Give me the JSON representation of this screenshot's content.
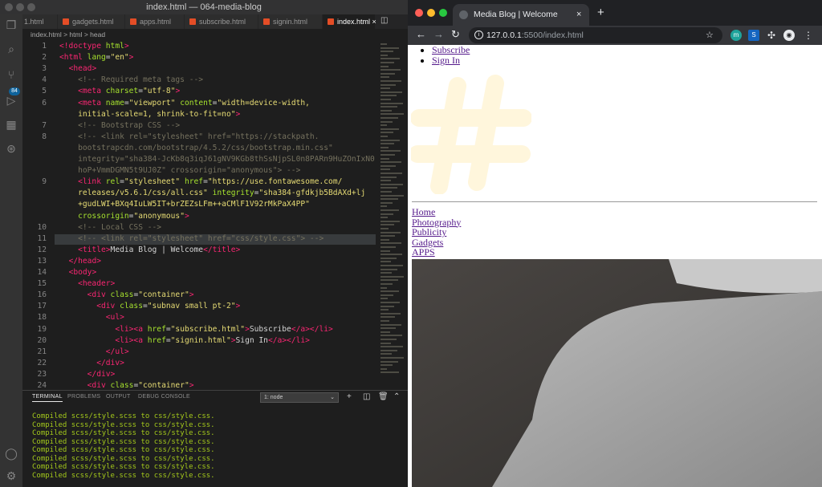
{
  "vscode": {
    "window_title": "index.html — 064-media-blog",
    "tabs": [
      "1.html",
      "gadgets.html",
      "apps.html",
      "subscribe.html",
      "signin.html",
      "index.html"
    ],
    "active_tab_close": "×",
    "breadcrumb": "index.html > html > head",
    "activity_badge": "84",
    "lines": [
      {
        "n": "1",
        "h": "<span class='t'>&lt;!doctype</span> <span class='a'>html</span><span class='t'>&gt;</span>"
      },
      {
        "n": "2",
        "h": "<span class='t'>&lt;html</span> <span class='a'>lang</span>=<span class='s'>\"en\"</span><span class='t'>&gt;</span>"
      },
      {
        "n": "3",
        "h": "  <span class='t'>&lt;head&gt;</span>"
      },
      {
        "n": "4",
        "h": "    <span class='c'>&lt;!-- Required meta tags --&gt;</span>"
      },
      {
        "n": "5",
        "h": "    <span class='t'>&lt;meta</span> <span class='a'>charset</span>=<span class='s'>\"utf-8\"</span><span class='t'>&gt;</span>"
      },
      {
        "n": "6",
        "h": "    <span class='t'>&lt;meta</span> <span class='a'>name</span>=<span class='s'>\"viewport\"</span> <span class='a'>content</span>=<span class='s'>\"width=device-width,</span>"
      },
      {
        "n": "",
        "h": "    <span class='s'>initial-scale=1, shrink-to-fit=no\"</span><span class='t'>&gt;</span>"
      },
      {
        "n": "7",
        "h": "    <span class='c'>&lt;!-- Bootstrap CSS --&gt;</span>"
      },
      {
        "n": "8",
        "h": "    <span class='c'>&lt;!-- &lt;link rel=\"stylesheet\" href=\"https://stackpath.</span>"
      },
      {
        "n": "",
        "h": "    <span class='c'>bootstrapcdn.com/bootstrap/4.5.2/css/bootstrap.min.css\"</span>"
      },
      {
        "n": "",
        "h": "    <span class='c'>integrity=\"sha384-JcKb8q3iqJ61gNV9KGb8thSsNjpSL0n8PARn9HuZOnIxN0</span>"
      },
      {
        "n": "",
        "h": "    <span class='c'>hoP+VmmDGMN5t9UJ0Z\" crossorigin=\"anonymous\"&gt; --&gt;</span>"
      },
      {
        "n": "9",
        "h": "    <span class='t'>&lt;link</span> <span class='a'>rel</span>=<span class='s'>\"stylesheet\"</span> <span class='a'>href</span>=<span class='s'>\"https://use.fontawesome.com/</span>"
      },
      {
        "n": "",
        "h": "    <span class='s'>releases/v5.6.1/css/all.css\"</span> <span class='a'>integrity</span>=<span class='s'>\"sha384-gfdkjb5BdAXd+lj</span>"
      },
      {
        "n": "",
        "h": "    <span class='s'>+gudLWI+BXq4IuLW5IT+brZEZsLFm++aCMlF1V92rMkPaX4PP\"</span>"
      },
      {
        "n": "",
        "h": "    <span class='a'>crossorigin</span>=<span class='s'>\"anonymous\"</span><span class='t'>&gt;</span>"
      },
      {
        "n": "10",
        "h": "    <span class='c'>&lt;!-- Local CSS --&gt;</span>"
      },
      {
        "n": "11",
        "h": "    <span class='c'>&lt;!-- &lt;link rel=\"stylesheet\" href=\"css/style.css\"&gt; --&gt;</span>"
      },
      {
        "n": "12",
        "h": "    <span class='t'>&lt;title&gt;</span>Media Blog | Welcome<span class='t'>&lt;/title&gt;</span>"
      },
      {
        "n": "13",
        "h": "  <span class='t'>&lt;/head&gt;</span>"
      },
      {
        "n": "14",
        "h": "  <span class='t'>&lt;body&gt;</span>"
      },
      {
        "n": "15",
        "h": "    <span class='t'>&lt;header&gt;</span>"
      },
      {
        "n": "16",
        "h": "      <span class='t'>&lt;div</span> <span class='a'>class</span>=<span class='s'>\"container\"</span><span class='t'>&gt;</span>"
      },
      {
        "n": "17",
        "h": "        <span class='t'>&lt;div</span> <span class='a'>class</span>=<span class='s'>\"subnav small pt-2\"</span><span class='t'>&gt;</span>"
      },
      {
        "n": "18",
        "h": "          <span class='t'>&lt;ul&gt;</span>"
      },
      {
        "n": "19",
        "h": "            <span class='t'>&lt;li&gt;&lt;a</span> <span class='a'>href</span>=<span class='s'>\"subscribe.html\"</span><span class='t'>&gt;</span>Subscribe<span class='t'>&lt;/a&gt;&lt;/li&gt;</span>"
      },
      {
        "n": "20",
        "h": "            <span class='t'>&lt;li&gt;&lt;a</span> <span class='a'>href</span>=<span class='s'>\"signin.html\"</span><span class='t'>&gt;</span>Sign In<span class='t'>&lt;/a&gt;&lt;/li&gt;</span>"
      },
      {
        "n": "21",
        "h": "          <span class='t'>&lt;/ul&gt;</span>"
      },
      {
        "n": "22",
        "h": "        <span class='t'>&lt;/div&gt;</span>"
      },
      {
        "n": "23",
        "h": "      <span class='t'>&lt;/div&gt;</span>"
      },
      {
        "n": "24",
        "h": "      <span class='t'>&lt;div</span> <span class='a'>class</span>=<span class='s'>\"container\"</span><span class='t'>&gt;</span>"
      }
    ],
    "panel_tabs": [
      "TERMINAL",
      "PROBLEMS",
      "OUTPUT",
      "DEBUG CONSOLE"
    ],
    "terminal_select": "1: node",
    "terminal_lines": [
      "Compiled scss/style.scss to css/style.css.",
      "Compiled scss/style.scss to css/style.css.",
      "Compiled scss/style.scss to css/style.css.",
      "Compiled scss/style.scss to css/style.css.",
      "Compiled scss/style.scss to css/style.css.",
      "Compiled scss/style.scss to css/style.css.",
      "Compiled scss/style.scss to css/style.css.",
      "Compiled scss/style.scss to css/style.css."
    ]
  },
  "chrome": {
    "tab_title": "Media Blog | Welcome",
    "close": "×",
    "new_tab": "+",
    "url_host": "127.0.0.1",
    "url_rest": ":5500/index.html"
  },
  "page": {
    "subnav": [
      "Subscribe",
      "Sign In"
    ],
    "main_nav": [
      "Home",
      "Photography",
      "Publicity",
      "Gadgets",
      "APPS"
    ]
  }
}
